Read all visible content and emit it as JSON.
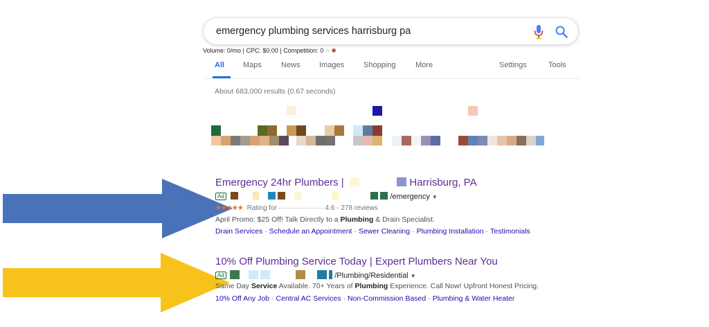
{
  "search": {
    "query": "emergency plumbing services harrisburg pa"
  },
  "keyword_stats": {
    "text": "Volume: 0/mo | CPC: $0.00 | Competition: 0",
    "star_icon": "star-icon",
    "bug_icon": "bug-icon"
  },
  "tabs": {
    "all": "All",
    "maps": "Maps",
    "news": "News",
    "images": "Images",
    "shopping": "Shopping",
    "more": "More",
    "settings": "Settings",
    "tools": "Tools"
  },
  "results": {
    "count_text": "About 683,000 results (0.67 seconds)"
  },
  "ads": [
    {
      "title_left": "Emergency 24hr Plumbers |",
      "title_right": "Harrisburg, PA",
      "badge": "Ad",
      "url_suffix": "/emergency",
      "rating_prefix": "Rating for",
      "rating_value": "4.6 - 278 reviews",
      "stars": "★★★★★",
      "desc_a": "April Promo: $25 Off! Talk Directly to a ",
      "desc_bold_1": "Plumbing",
      "desc_b": " & Drain Specialist.",
      "sitelinks": [
        "Drain Services",
        "Schedule an Appointment",
        "Sewer Cleaning",
        "Plumbing Installation",
        "Testimonials"
      ]
    },
    {
      "title": "10% Off Plumbing Service Today | Expert Plumbers Near You",
      "badge": "Ad",
      "url_suffix": "/Plumbing/Residential",
      "desc_a": "Same Day ",
      "desc_bold_1": "Service",
      "desc_b": " Available. 70+ Years of ",
      "desc_bold_2": "Plumbing",
      "desc_c": " Experience. Call Now! Upfront Honest Pricing.",
      "sitelinks": [
        "10% Off Any Job",
        "Central AC Services",
        "Non-Commission Based",
        "Plumbing & Water Heater"
      ]
    }
  ],
  "colors": {
    "arrow_blue": "#4a72b8",
    "arrow_yellow": "#f7c21b",
    "link_blue": "#1a0dab",
    "visited_purple": "#5e2b97",
    "tab_blue": "#1a73e8"
  }
}
